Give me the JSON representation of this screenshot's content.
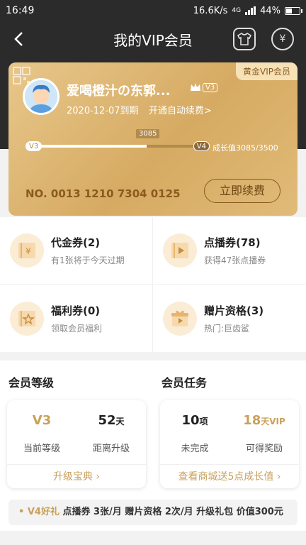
{
  "status": {
    "time": "16:49",
    "speed": "16.6K/s",
    "network": "4G",
    "battery": "44%"
  },
  "nav": {
    "title": "我的VIP会员"
  },
  "card": {
    "badge": "黄金VIP会员",
    "username": "爱喝橙汁の东郭...",
    "level_tag": "V3",
    "expiry": "2020-12-07到期",
    "auto_renew": "开通自动续费>",
    "progress_from": "V3",
    "progress_to": "V4",
    "progress_value": "3085",
    "progress_fraction": 0.68,
    "growth": "成长值3085/3500",
    "card_no": "NO. 0013 1210 7304 0125",
    "renew_button": "立即续费"
  },
  "coupons": [
    {
      "title": "代金券(2)",
      "sub": "有1张将于今天过期"
    },
    {
      "title": "点播券(78)",
      "sub": "获得47张点播券"
    },
    {
      "title": "福利券(0)",
      "sub": "领取会员福利"
    },
    {
      "title": "赠片资格(3)",
      "sub": "热门:巨齿鲨"
    }
  ],
  "level": {
    "title": "会员等级",
    "current_value": "V3",
    "current_label": "当前等级",
    "days_value": "52",
    "days_unit": "天",
    "days_label": "距离升级",
    "link": "升级宝典 ›"
  },
  "tasks": {
    "title": "会员任务",
    "todo_value": "10",
    "todo_unit": "项",
    "todo_label": "未完成",
    "reward_value": "18",
    "reward_unit": "天VIP",
    "reward_label": "可得奖励",
    "link": "查看商城送5点成长值 ›"
  },
  "gift": {
    "tag": "• V4好礼",
    "text": "点播券 3张/月  赠片资格 2次/月  升级礼包 价值300元"
  }
}
